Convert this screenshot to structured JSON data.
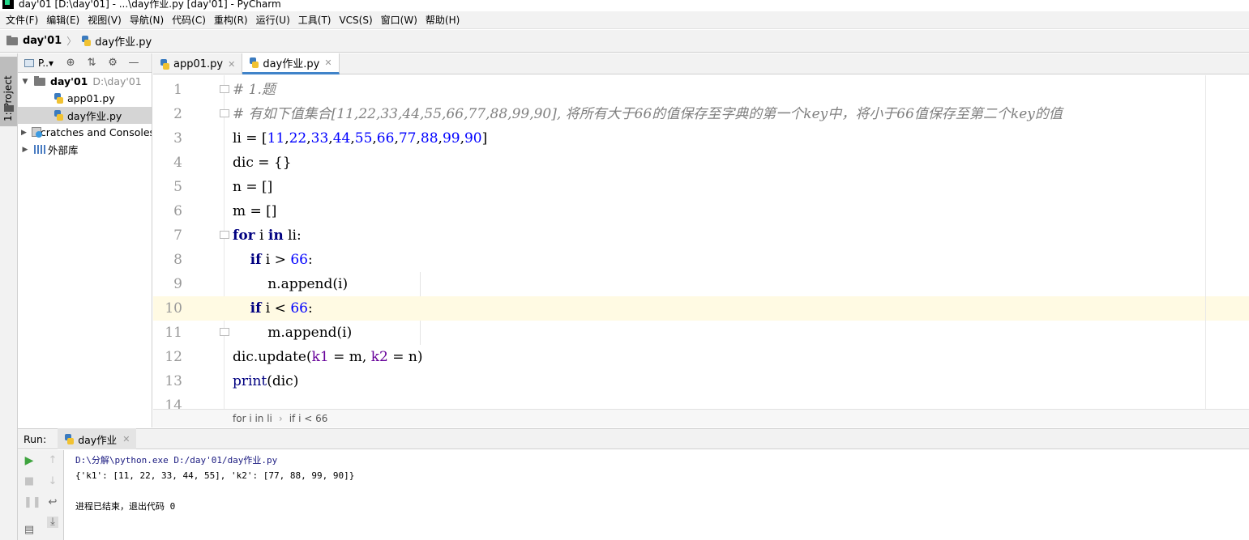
{
  "window": {
    "title": "day'01 [D:\\day'01] - ...\\day作业.py [day'01] - PyCharm"
  },
  "menu": [
    "文件(F)",
    "编辑(E)",
    "视图(V)",
    "导航(N)",
    "代码(C)",
    "重构(R)",
    "运行(U)",
    "工具(T)",
    "VCS(S)",
    "窗口(W)",
    "帮助(H)"
  ],
  "navbar": {
    "project": "day'01",
    "file": "day作业.py"
  },
  "left_strip": {
    "project_tab": "1: Project"
  },
  "project_panel": {
    "header_label": "P..▾",
    "tree": [
      {
        "label": "day'01",
        "path": "D:\\day'01"
      },
      {
        "label": "app01.py"
      },
      {
        "label": "day作业.py"
      },
      {
        "label": "Scratches and Consoles"
      },
      {
        "label": "外部库"
      }
    ]
  },
  "editor_tabs": [
    {
      "label": "app01.py",
      "active": false
    },
    {
      "label": "day作业.py",
      "active": true
    }
  ],
  "code": {
    "line_numbers": [
      "1",
      "2",
      "3",
      "4",
      "5",
      "6",
      "7",
      "8",
      "9",
      "10",
      "11",
      "12",
      "13",
      "14"
    ],
    "current_line": 10,
    "lines": [
      "# 1.题",
      "# 有如下值集合[11,22,33,44,55,66,77,88,99,90], 将所有大于66的值保存至字典的第一个key中，将小于66值保存至第二个key的值",
      "li = [11,22,33,44,55,66,77,88,99,90]",
      "dic = {}",
      "n = []",
      "m = []",
      "for i in li:",
      "    if i > 66:",
      "        n.append(i)",
      "    if i < 66:",
      "        m.append(i)",
      "dic.update(k1 = m, k2 = n)",
      "print(dic)",
      ""
    ]
  },
  "editor_breadcrumb": [
    "for i in li",
    "if i < 66"
  ],
  "run": {
    "title": "Run:",
    "tab": "day作业",
    "output": [
      "D:\\分解\\python.exe D:/day'01/day作业.py",
      "{'k1': [11, 22, 33, 44, 55], 'k2': [77, 88, 99, 90]}",
      "",
      "进程已结束，退出代码 0"
    ]
  },
  "colors": {
    "keyword": "#000080",
    "number": "#0000ff",
    "comment": "#808080",
    "param": "#660099",
    "current_line": "#fffae3",
    "tab_accent": "#4083c9"
  }
}
